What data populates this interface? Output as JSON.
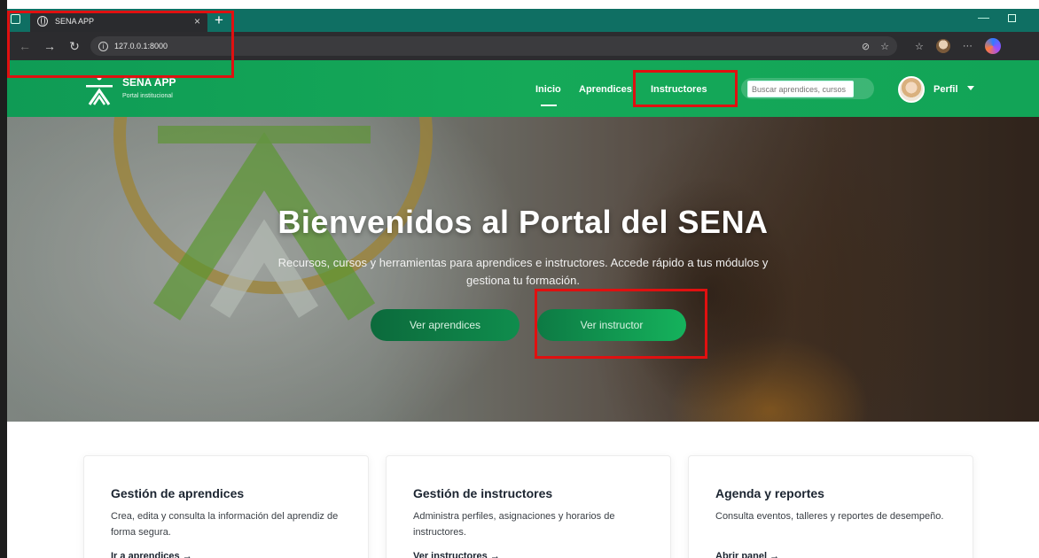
{
  "browser": {
    "tab_title": "SENA APP",
    "tab_close": "×",
    "new_tab": "+",
    "url": "127.0.0.1:8000",
    "window_min": "—"
  },
  "site": {
    "logo_title": "SENA APP",
    "logo_subtitle": "Portal institucional",
    "nav": {
      "inicio": "Inicio",
      "aprendices": "Aprendices",
      "instructores": "Instructores"
    },
    "search_placeholder": "Buscar aprendices, cursos",
    "profile_label": "Perfil"
  },
  "hero": {
    "title": "Bienvenidos al Portal del SENA",
    "subtitle": "Recursos, cursos y herramientas para aprendices e instructores. Accede rápido a tus módulos y gestiona tu formación.",
    "btn_aprendices": "Ver aprendices",
    "btn_instructor": "Ver instructor"
  },
  "cards": [
    {
      "title": "Gestión de aprendices",
      "text": "Crea, edita y consulta la información del aprendiz de forma segura.",
      "cta": "Ir a aprendices →"
    },
    {
      "title": "Gestión de instructores",
      "text": "Administra perfiles, asignaciones y horarios de instructores.",
      "cta": "Ver instructores →"
    },
    {
      "title": "Agenda y reportes",
      "text": "Consulta eventos, talleres y reportes de desempeño.",
      "cta": "Abrir panel →"
    }
  ],
  "colors": {
    "brand_green": "#15a958",
    "annotation_red": "#e01010"
  }
}
